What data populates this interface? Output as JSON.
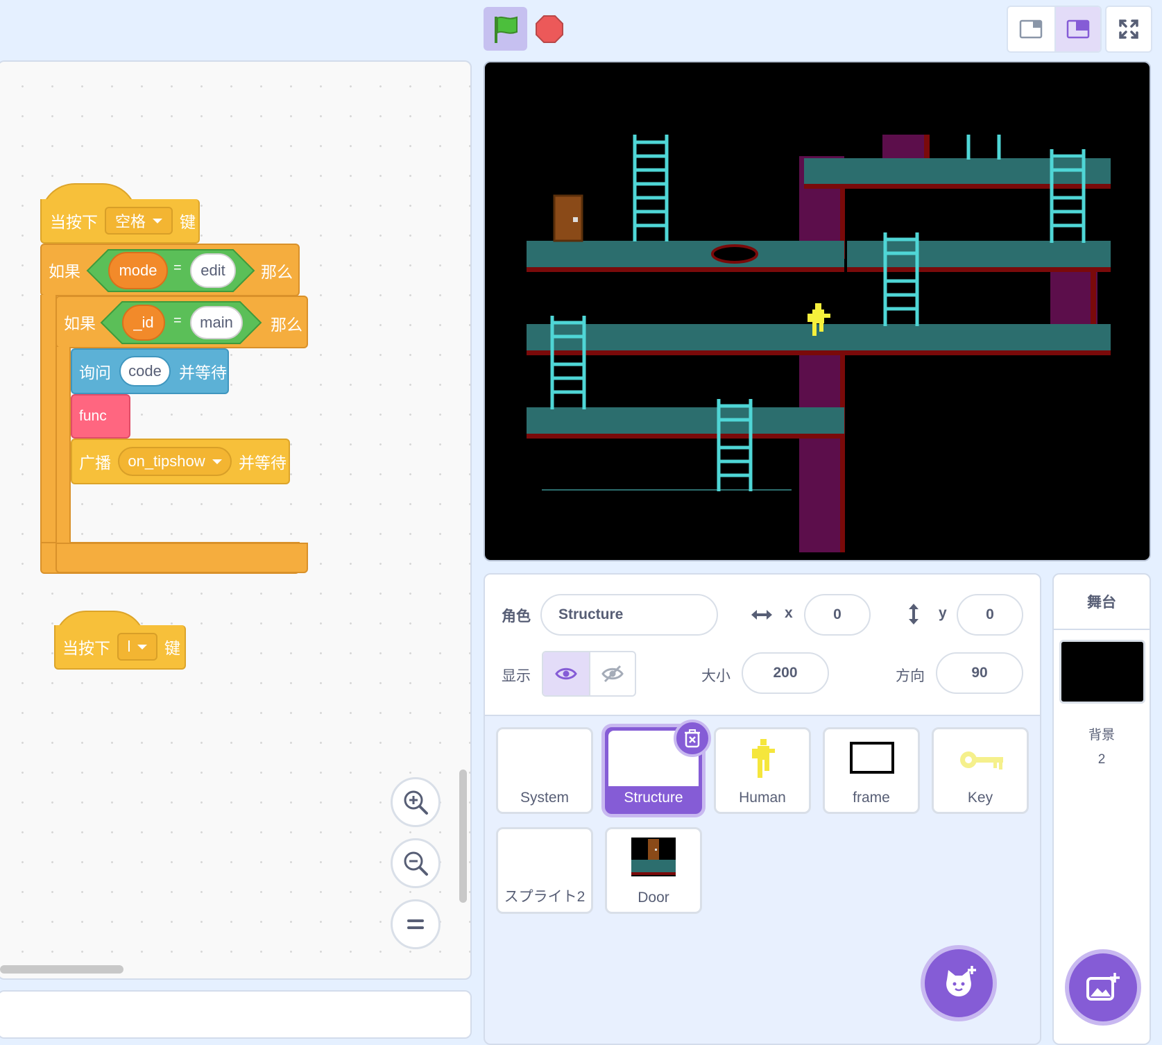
{
  "colors": {
    "accent": "#855cd6",
    "event_block": "#f7c03a",
    "control_block": "#f5ad3e",
    "operator_block": "#5bbf58",
    "variable_reporter": "#f28a2a",
    "sensing_block": "#5cb1d6",
    "custom_block": "#ff6680",
    "stage_background": "#000000",
    "platform_teal": "#2c6e6e",
    "wall_purple": "#5c0e4b",
    "ladder_cyan": "#4fd6d6",
    "human_yellow": "#f5f03c"
  },
  "icons": {
    "green_flag": "green-flag-icon",
    "stop": "stop-icon",
    "small_stage": "small-stage-layout-icon",
    "normal_stage": "normal-stage-layout-icon",
    "fullscreen": "fullscreen-icon",
    "zoom_in": "zoom-in-icon",
    "zoom_out": "zoom-out-icon",
    "zoom_reset": "zoom-reset-icon",
    "show": "eye-icon",
    "hide": "eye-slash-icon",
    "delete": "trash-icon",
    "add_sprite": "cat-plus-icon",
    "add_backdrop": "image-plus-icon"
  },
  "scripts": {
    "script1": {
      "hat_when": "当按下",
      "hat_key": "空格",
      "hat_suffix": "键",
      "if1_label": "如果",
      "if1_var": "mode",
      "if1_op": "=",
      "if1_value": "edit",
      "if1_then": "那么",
      "if2_label": "如果",
      "if2_var": "_id",
      "if2_op": "=",
      "if2_value": "main",
      "if2_then": "那么",
      "ask_label": "询问",
      "ask_value": "code",
      "ask_suffix": "并等待",
      "func_label": "func",
      "broadcast_label": "广播",
      "broadcast_message": "on_tipshow",
      "broadcast_suffix": "并等待"
    },
    "script2": {
      "hat_when": "当按下",
      "hat_key": "l",
      "hat_suffix": "键"
    }
  },
  "sprite_info": {
    "sprite_label": "角色",
    "sprite_name": "Structure",
    "x_label": "x",
    "x_value": "0",
    "y_label": "y",
    "y_value": "0",
    "show_label": "显示",
    "visible": true,
    "size_label": "大小",
    "size_value": "200",
    "direction_label": "方向",
    "direction_value": "90"
  },
  "sprites": [
    {
      "name": "System",
      "selected": false
    },
    {
      "name": "Structure",
      "selected": true
    },
    {
      "name": "Human",
      "selected": false
    },
    {
      "name": "frame",
      "selected": false
    },
    {
      "name": "Key",
      "selected": false
    },
    {
      "name": "スプライト2",
      "selected": false
    },
    {
      "name": "Door",
      "selected": false
    }
  ],
  "stage_pane": {
    "title": "舞台",
    "backdrops_label": "背景",
    "backdrops_count": "2"
  }
}
